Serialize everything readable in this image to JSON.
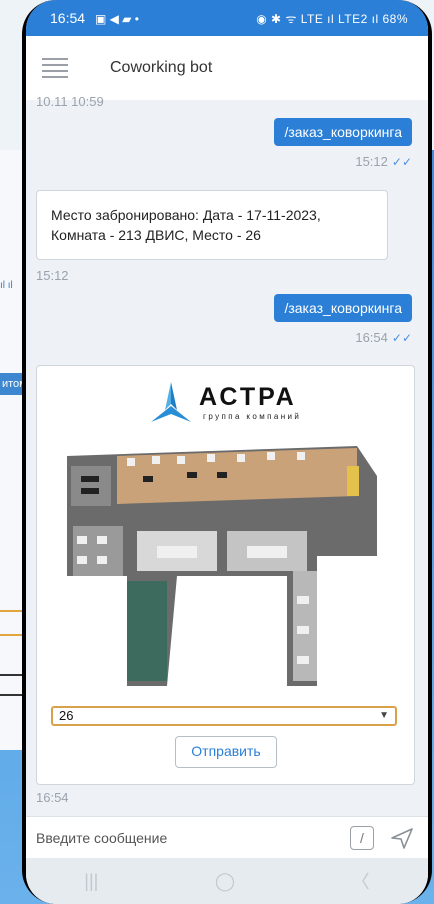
{
  "status_bar": {
    "time": "16:54",
    "left_icons": "▣ ◀ ▰ •",
    "right_text": "◉ ✱ ᯤ LTE ıl LTE2 ıl 68%"
  },
  "app_bar": {
    "title": "Coworking bot",
    "menu_icon": "menu-icon"
  },
  "background": {
    "side_label": "итом",
    "side_signal": "ıl ıl"
  },
  "messages": {
    "first_ts": "10.11 10:59",
    "cmd1": {
      "text": "/заказ_коворкинга",
      "time": "15:12"
    },
    "reply": {
      "text": "Место забронировано: Дата - 17-11-2023, Комната - 213 ДВИС, Место - 26",
      "time": "15:12"
    },
    "cmd2": {
      "text": "/заказ_коворкинга",
      "time": "16:54"
    },
    "card": {
      "brand": "АСТРА",
      "tagline": "группа компаний",
      "select_value": "26",
      "button": "Отправить",
      "time": "16:54"
    }
  },
  "input": {
    "placeholder": "Введите сообщение",
    "slash": "/"
  },
  "nav": {
    "recent": "|||",
    "home": "◯",
    "back": "〈"
  },
  "colors": {
    "accent": "#2b7fd6",
    "select_border": "#d9a24a"
  }
}
